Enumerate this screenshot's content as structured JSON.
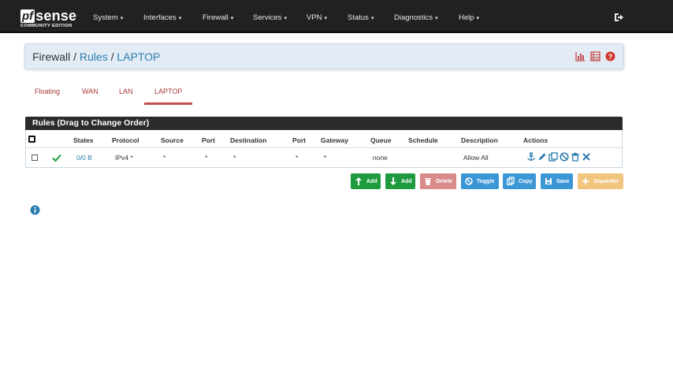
{
  "logo": {
    "pf": "pf",
    "sense": "sense",
    "sub": "COMMUNITY EDITION"
  },
  "nav": {
    "items": [
      {
        "label": "System"
      },
      {
        "label": "Interfaces"
      },
      {
        "label": "Firewall"
      },
      {
        "label": "Services"
      },
      {
        "label": "VPN"
      },
      {
        "label": "Status"
      },
      {
        "label": "Diagnostics"
      },
      {
        "label": "Help"
      }
    ],
    "caret": "▾"
  },
  "breadcrumb": {
    "root": "Firewall",
    "level2": "Rules",
    "level3": "LAPTOP",
    "sep": "/"
  },
  "tabs": [
    {
      "label": "Floating"
    },
    {
      "label": "WAN"
    },
    {
      "label": "LAN"
    },
    {
      "label": "LAPTOP"
    }
  ],
  "rules": {
    "title": "Rules (Drag to Change Order)",
    "headers": {
      "states": "States",
      "protocol": "Protocol",
      "source": "Source",
      "port": "Port",
      "destination": "Destination",
      "port2": "Port",
      "gateway": "Gateway",
      "queue": "Queue",
      "schedule": "Schedule",
      "description": "Description",
      "actions": "Actions"
    },
    "row": {
      "states": "0/0 B",
      "protocol": "IPv4 *",
      "source": "*",
      "port": "*",
      "destination": "*",
      "port2": "*",
      "gateway": "*",
      "queue": "none",
      "description": "Allow All"
    }
  },
  "buttons": {
    "add_top": "Add",
    "add_bottom": "Add",
    "delete": "Delete",
    "toggle": "Toggle",
    "copy": "Copy",
    "save": "Save",
    "separator": "Separator"
  },
  "colors": {
    "navbar": "#212121",
    "link": "#2b7cae",
    "tab_active": "#c24d4d",
    "green": "#1f9b3f",
    "blue": "#3b96d6",
    "red_disabled": "#d98a8a",
    "orange_disabled": "#f1c57d"
  }
}
